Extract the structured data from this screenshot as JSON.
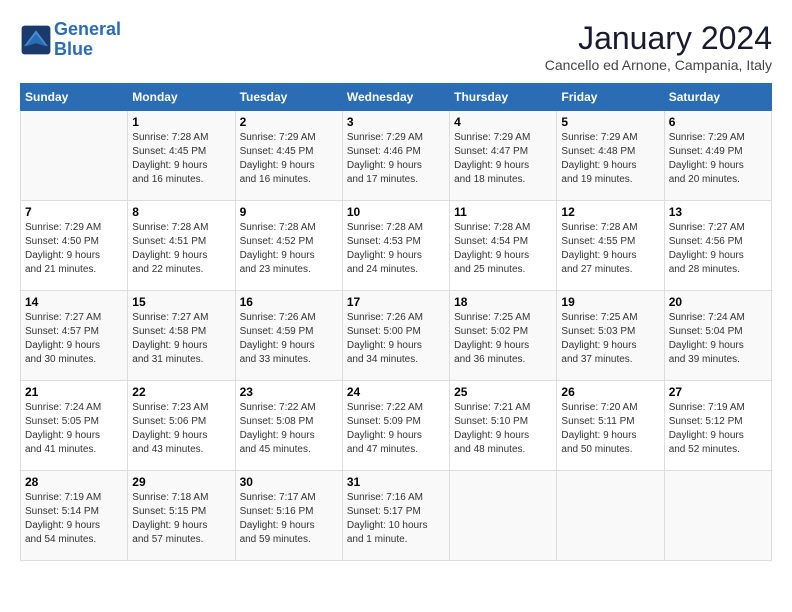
{
  "logo": {
    "line1": "General",
    "line2": "Blue"
  },
  "title": "January 2024",
  "location": "Cancello ed Arnone, Campania, Italy",
  "days_of_week": [
    "Sunday",
    "Monday",
    "Tuesday",
    "Wednesday",
    "Thursday",
    "Friday",
    "Saturday"
  ],
  "weeks": [
    [
      {
        "day": "",
        "info": ""
      },
      {
        "day": "1",
        "info": "Sunrise: 7:28 AM\nSunset: 4:45 PM\nDaylight: 9 hours\nand 16 minutes."
      },
      {
        "day": "2",
        "info": "Sunrise: 7:29 AM\nSunset: 4:45 PM\nDaylight: 9 hours\nand 16 minutes."
      },
      {
        "day": "3",
        "info": "Sunrise: 7:29 AM\nSunset: 4:46 PM\nDaylight: 9 hours\nand 17 minutes."
      },
      {
        "day": "4",
        "info": "Sunrise: 7:29 AM\nSunset: 4:47 PM\nDaylight: 9 hours\nand 18 minutes."
      },
      {
        "day": "5",
        "info": "Sunrise: 7:29 AM\nSunset: 4:48 PM\nDaylight: 9 hours\nand 19 minutes."
      },
      {
        "day": "6",
        "info": "Sunrise: 7:29 AM\nSunset: 4:49 PM\nDaylight: 9 hours\nand 20 minutes."
      }
    ],
    [
      {
        "day": "7",
        "info": "Sunrise: 7:29 AM\nSunset: 4:50 PM\nDaylight: 9 hours\nand 21 minutes."
      },
      {
        "day": "8",
        "info": "Sunrise: 7:28 AM\nSunset: 4:51 PM\nDaylight: 9 hours\nand 22 minutes."
      },
      {
        "day": "9",
        "info": "Sunrise: 7:28 AM\nSunset: 4:52 PM\nDaylight: 9 hours\nand 23 minutes."
      },
      {
        "day": "10",
        "info": "Sunrise: 7:28 AM\nSunset: 4:53 PM\nDaylight: 9 hours\nand 24 minutes."
      },
      {
        "day": "11",
        "info": "Sunrise: 7:28 AM\nSunset: 4:54 PM\nDaylight: 9 hours\nand 25 minutes."
      },
      {
        "day": "12",
        "info": "Sunrise: 7:28 AM\nSunset: 4:55 PM\nDaylight: 9 hours\nand 27 minutes."
      },
      {
        "day": "13",
        "info": "Sunrise: 7:27 AM\nSunset: 4:56 PM\nDaylight: 9 hours\nand 28 minutes."
      }
    ],
    [
      {
        "day": "14",
        "info": "Sunrise: 7:27 AM\nSunset: 4:57 PM\nDaylight: 9 hours\nand 30 minutes."
      },
      {
        "day": "15",
        "info": "Sunrise: 7:27 AM\nSunset: 4:58 PM\nDaylight: 9 hours\nand 31 minutes."
      },
      {
        "day": "16",
        "info": "Sunrise: 7:26 AM\nSunset: 4:59 PM\nDaylight: 9 hours\nand 33 minutes."
      },
      {
        "day": "17",
        "info": "Sunrise: 7:26 AM\nSunset: 5:00 PM\nDaylight: 9 hours\nand 34 minutes."
      },
      {
        "day": "18",
        "info": "Sunrise: 7:25 AM\nSunset: 5:02 PM\nDaylight: 9 hours\nand 36 minutes."
      },
      {
        "day": "19",
        "info": "Sunrise: 7:25 AM\nSunset: 5:03 PM\nDaylight: 9 hours\nand 37 minutes."
      },
      {
        "day": "20",
        "info": "Sunrise: 7:24 AM\nSunset: 5:04 PM\nDaylight: 9 hours\nand 39 minutes."
      }
    ],
    [
      {
        "day": "21",
        "info": "Sunrise: 7:24 AM\nSunset: 5:05 PM\nDaylight: 9 hours\nand 41 minutes."
      },
      {
        "day": "22",
        "info": "Sunrise: 7:23 AM\nSunset: 5:06 PM\nDaylight: 9 hours\nand 43 minutes."
      },
      {
        "day": "23",
        "info": "Sunrise: 7:22 AM\nSunset: 5:08 PM\nDaylight: 9 hours\nand 45 minutes."
      },
      {
        "day": "24",
        "info": "Sunrise: 7:22 AM\nSunset: 5:09 PM\nDaylight: 9 hours\nand 47 minutes."
      },
      {
        "day": "25",
        "info": "Sunrise: 7:21 AM\nSunset: 5:10 PM\nDaylight: 9 hours\nand 48 minutes."
      },
      {
        "day": "26",
        "info": "Sunrise: 7:20 AM\nSunset: 5:11 PM\nDaylight: 9 hours\nand 50 minutes."
      },
      {
        "day": "27",
        "info": "Sunrise: 7:19 AM\nSunset: 5:12 PM\nDaylight: 9 hours\nand 52 minutes."
      }
    ],
    [
      {
        "day": "28",
        "info": "Sunrise: 7:19 AM\nSunset: 5:14 PM\nDaylight: 9 hours\nand 54 minutes."
      },
      {
        "day": "29",
        "info": "Sunrise: 7:18 AM\nSunset: 5:15 PM\nDaylight: 9 hours\nand 57 minutes."
      },
      {
        "day": "30",
        "info": "Sunrise: 7:17 AM\nSunset: 5:16 PM\nDaylight: 9 hours\nand 59 minutes."
      },
      {
        "day": "31",
        "info": "Sunrise: 7:16 AM\nSunset: 5:17 PM\nDaylight: 10 hours\nand 1 minute."
      },
      {
        "day": "",
        "info": ""
      },
      {
        "day": "",
        "info": ""
      },
      {
        "day": "",
        "info": ""
      }
    ]
  ]
}
